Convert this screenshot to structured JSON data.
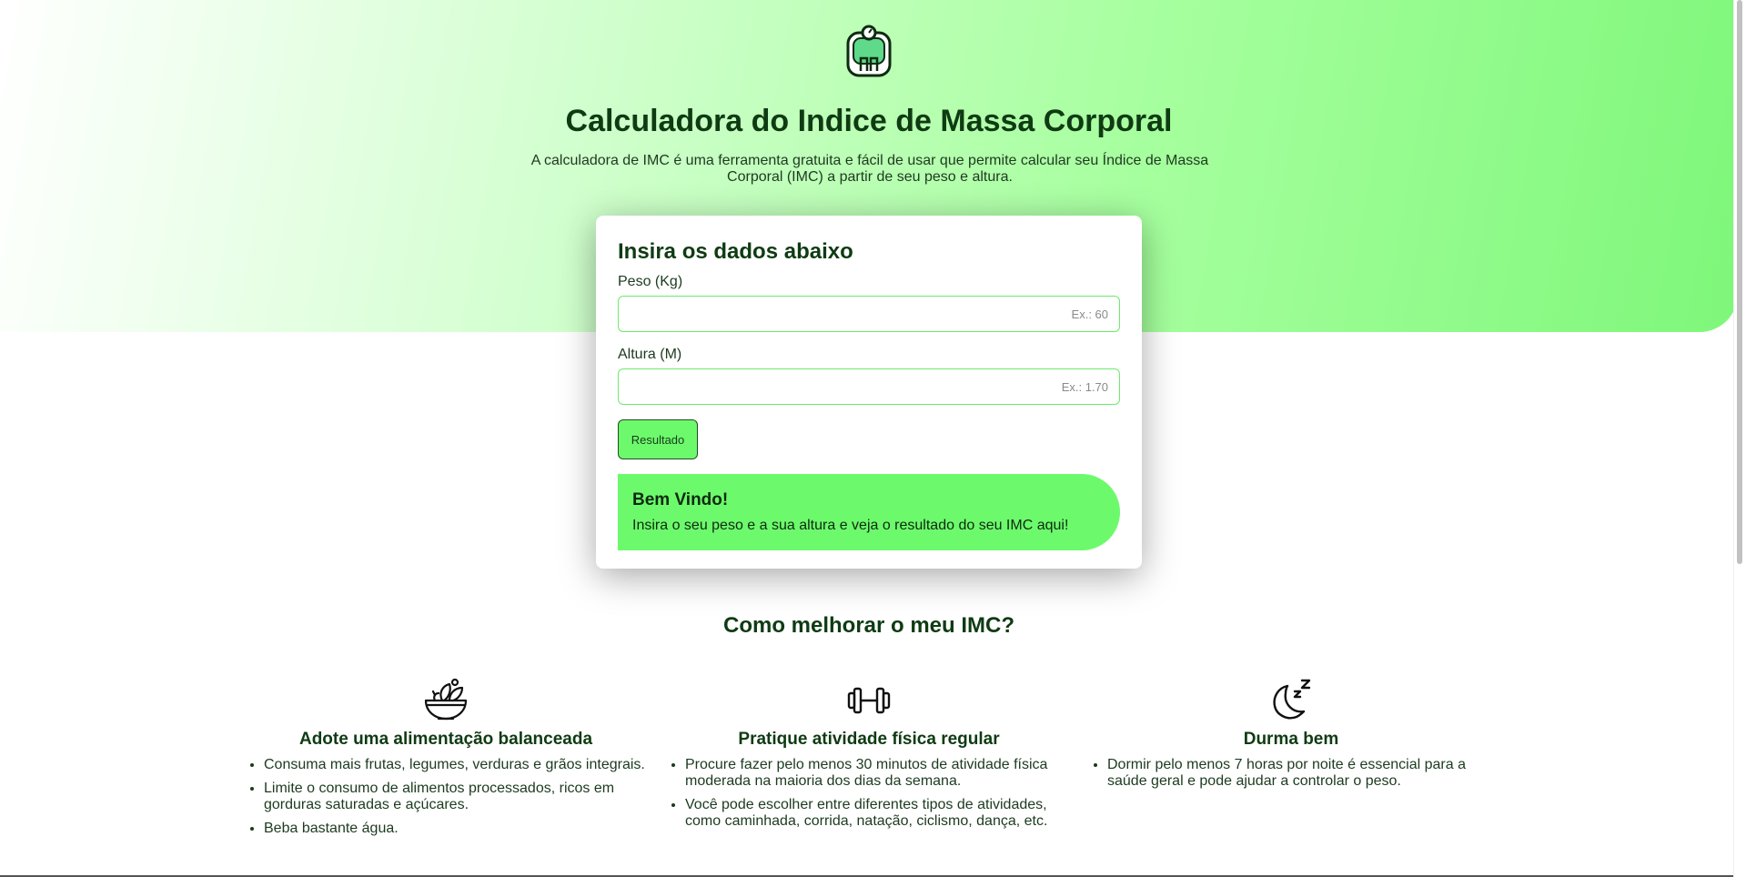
{
  "header": {
    "title": "Calculadora do Indice de Massa Corporal",
    "subtitle": "A calculadora de IMC é uma ferramenta gratuita e fácil de usar que permite calcular seu Índice de Massa Corporal (IMC) a partir de seu peso e altura."
  },
  "form": {
    "title": "Insira os dados abaixo",
    "weight_label": "Peso (Kg)",
    "weight_value": "",
    "weight_placeholder": "Ex.: 60",
    "height_label": "Altura (M)",
    "height_value": "",
    "height_placeholder": "Ex.: 1.70",
    "submit_label": "Resultado"
  },
  "result": {
    "title": "Bem Vindo!",
    "text": "Insira o seu peso e a sua altura e veja o resultado do seu IMC aqui!"
  },
  "tips": {
    "heading": "Como melhorar o meu IMC?",
    "items": [
      {
        "icon": "salad-bowl-icon",
        "title": "Adote uma alimentação balanceada",
        "bullets": [
          "Consuma mais frutas, legumes, verduras e grãos integrais.",
          "Limite o consumo de alimentos processados, ricos em gorduras saturadas e açúcares.",
          "Beba bastante água."
        ]
      },
      {
        "icon": "dumbbell-icon",
        "title": "Pratique atividade física regular",
        "bullets": [
          "Procure fazer pelo menos 30 minutos de atividade física moderada na maioria dos dias da semana.",
          "Você pode escolher entre diferentes tipos de atividades, como caminhada, corrida, natação, ciclismo, dança, etc."
        ]
      },
      {
        "icon": "moon-sleep-icon",
        "title": "Durma bem",
        "bullets": [
          "Dormir pelo menos 7 horas por noite é essencial para a saúde geral e pode ajudar a controlar o peso."
        ]
      }
    ]
  },
  "colors": {
    "accent": "#6cfa6c",
    "heading": "#0f3b13",
    "input_border": "#6eea6b"
  },
  "logo_icon": "scale-person-icon"
}
